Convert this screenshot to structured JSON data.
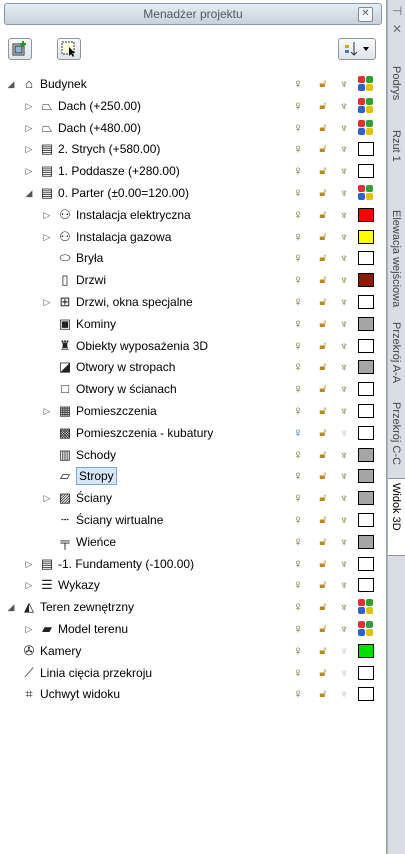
{
  "panel": {
    "title": "Menadżer projektu",
    "close_label": "✕"
  },
  "toolbar": {
    "btn1_icon": "add-icon",
    "btn2_icon": "select-icon",
    "dropdown_icon": "filter-icon"
  },
  "columns": {
    "visibility_icon": "bulb-icon",
    "lock_icon": "lock-icon",
    "print_icon": "goblet-icon",
    "color_icon": "color-swatch-icon"
  },
  "tree": [
    {
      "label": "Budynek",
      "icon": "house-icon",
      "level": 0,
      "expander": "collapse",
      "swatch": "multi"
    },
    {
      "label": "Dach (+250.00)",
      "icon": "roof-icon",
      "level": 1,
      "expander": "expand",
      "swatch": "multi"
    },
    {
      "label": "Dach (+480.00)",
      "icon": "roof-icon",
      "level": 1,
      "expander": "expand",
      "swatch": "multi"
    },
    {
      "label": "2. Strych (+580.00)",
      "icon": "storey-icon",
      "level": 1,
      "expander": "expand",
      "swatch": "#ffffff"
    },
    {
      "label": "1. Poddasze (+280.00)",
      "icon": "storey-icon",
      "level": 1,
      "expander": "expand",
      "swatch": "#ffffff"
    },
    {
      "label": "0. Parter (±0.00=120.00)",
      "icon": "storey-icon",
      "level": 1,
      "expander": "collapse",
      "swatch": "multi"
    },
    {
      "label": "Instalacja elektryczna",
      "icon": "installation-icon",
      "level": 2,
      "expander": "expand",
      "swatch": "#ff0000"
    },
    {
      "label": "Instalacja gazowa",
      "icon": "installation-icon",
      "level": 2,
      "expander": "expand",
      "swatch": "#ffff00"
    },
    {
      "label": "Bryła",
      "icon": "solid-icon",
      "level": 2,
      "expander": "",
      "swatch": "#ffffff"
    },
    {
      "label": "Drzwi",
      "icon": "door-icon",
      "level": 2,
      "expander": "",
      "swatch": "#8b1a00"
    },
    {
      "label": "Drzwi, okna specjalne",
      "icon": "window-icon",
      "level": 2,
      "expander": "expand",
      "swatch": "#ffffff"
    },
    {
      "label": "Kominy",
      "icon": "chimney-icon",
      "level": 2,
      "expander": "",
      "swatch": "#a6a6a6"
    },
    {
      "label": "Obiekty wyposażenia 3D",
      "icon": "furniture-icon",
      "level": 2,
      "expander": "",
      "swatch": "#ffffff"
    },
    {
      "label": "Otwory w stropach",
      "icon": "slab-opening-icon",
      "level": 2,
      "expander": "",
      "swatch": "#a6a6a6"
    },
    {
      "label": "Otwory w ścianach",
      "icon": "wall-opening-icon",
      "level": 2,
      "expander": "",
      "swatch": "#ffffff"
    },
    {
      "label": "Pomieszczenia",
      "icon": "room-icon",
      "level": 2,
      "expander": "expand",
      "swatch": "#ffffff"
    },
    {
      "label": "Pomieszczenia - kubatury",
      "icon": "room-volume-icon",
      "level": 2,
      "expander": "",
      "swatch": "#ffffff",
      "bulb": "blue",
      "dim": true
    },
    {
      "label": "Schody",
      "icon": "stairs-icon",
      "level": 2,
      "expander": "",
      "swatch": "#a6a6a6"
    },
    {
      "label": "Stropy",
      "icon": "slab-icon",
      "level": 2,
      "expander": "",
      "swatch": "#a6a6a6",
      "selected": true
    },
    {
      "label": "Ściany",
      "icon": "wall-icon",
      "level": 2,
      "expander": "expand",
      "swatch": "#a6a6a6"
    },
    {
      "label": "Ściany wirtualne",
      "icon": "virtual-wall-icon",
      "level": 2,
      "expander": "",
      "swatch": "#ffffff"
    },
    {
      "label": "Wieńce",
      "icon": "ring-beam-icon",
      "level": 2,
      "expander": "",
      "swatch": "#a6a6a6"
    },
    {
      "label": "-1. Fundamenty (-100.00)",
      "icon": "storey-icon",
      "level": 1,
      "expander": "expand",
      "swatch": "#ffffff"
    },
    {
      "label": "Wykazy",
      "icon": "list-icon",
      "level": 1,
      "expander": "expand",
      "swatch": "#ffffff"
    },
    {
      "label": "Teren zewnętrzny",
      "icon": "terrain-icon",
      "level": 0,
      "expander": "collapse",
      "swatch": "multi"
    },
    {
      "label": "Model terenu",
      "icon": "terrain-model-icon",
      "level": 1,
      "expander": "expand",
      "swatch": "multi"
    },
    {
      "label": "Kamery",
      "icon": "camera-icon",
      "level": 0,
      "expander": "",
      "swatch": "#00e000",
      "dim": true
    },
    {
      "label": "Linia cięcia przekroju",
      "icon": "section-line-icon",
      "level": 0,
      "expander": "",
      "swatch": "#ffffff",
      "dim": true
    },
    {
      "label": "Uchwyt widoku",
      "icon": "view-handle-icon",
      "level": 0,
      "expander": "",
      "swatch": "#ffffff",
      "dim": true
    }
  ],
  "side_tabs": [
    {
      "label": "Podrys"
    },
    {
      "label": "Rzut 1"
    },
    {
      "label": "Elewacja wejściowa"
    },
    {
      "label": "Przekrój A-A"
    },
    {
      "label": "Przekrój C-C"
    },
    {
      "label": "Widok 3D",
      "active": true
    }
  ],
  "side_buttons": {
    "pin_icon": "pin-icon",
    "close_icon": "close-icon"
  }
}
